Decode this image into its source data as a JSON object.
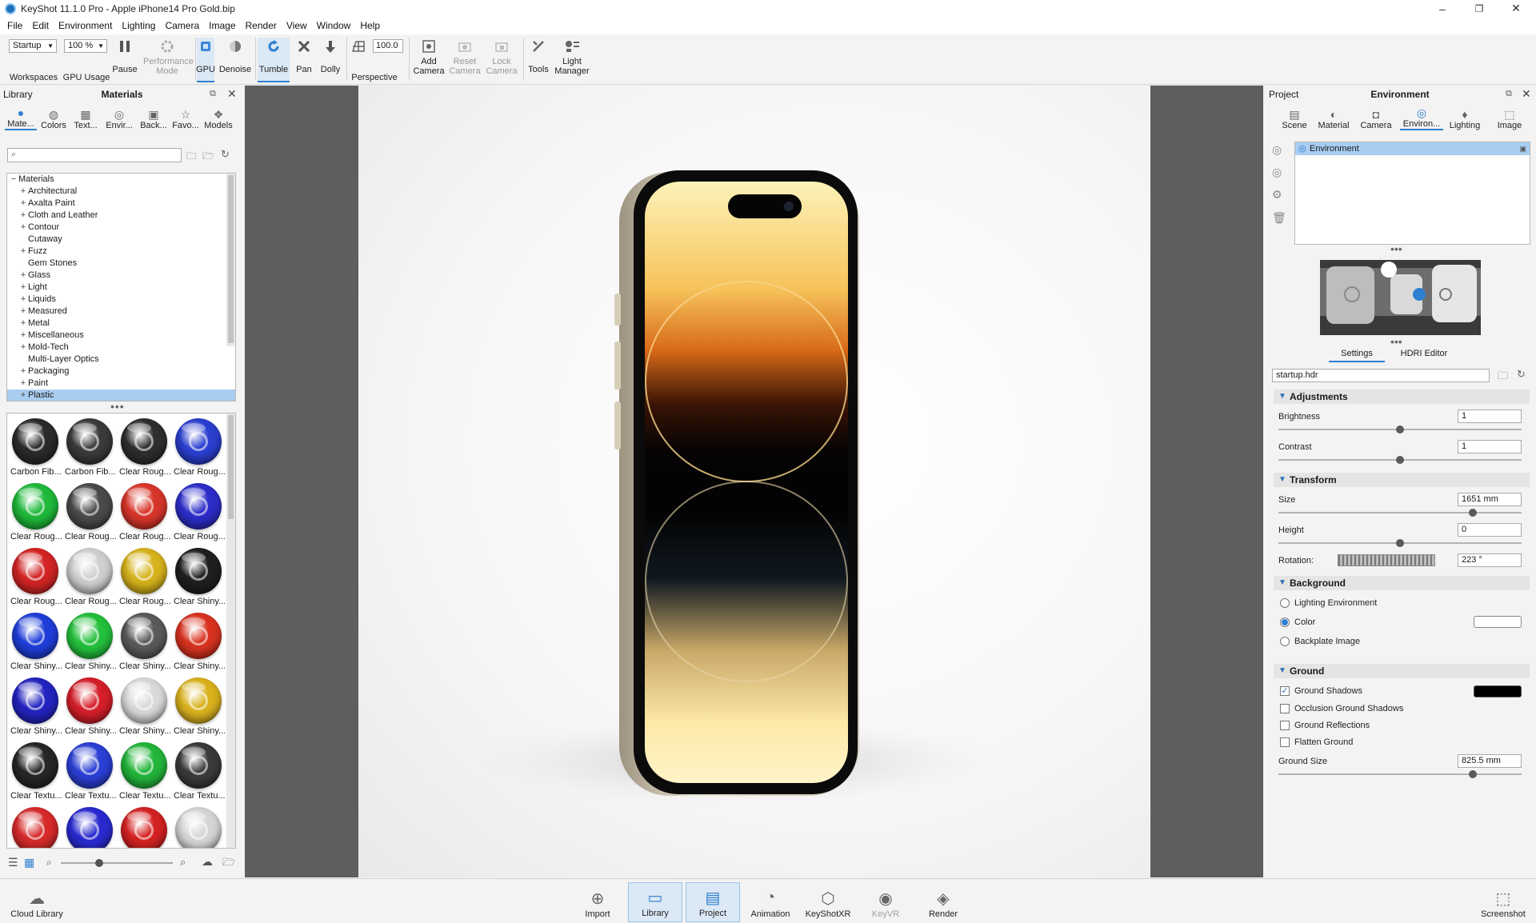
{
  "titlebar": {
    "title": "KeyShot 11.1.0 Pro  - Apple iPhone14 Pro Gold.bip",
    "minimize": "–",
    "maximize": "❐",
    "close": "✕"
  },
  "menubar": [
    "File",
    "Edit",
    "Environment",
    "Lighting",
    "Camera",
    "Image",
    "Render",
    "View",
    "Window",
    "Help"
  ],
  "toolbar": {
    "workspace_value": "Startup",
    "gpu_usage_value": "100 %",
    "perspective_value": "100.0",
    "buttons": {
      "workspaces": "Workspaces",
      "gpu_usage": "GPU Usage",
      "pause": "Pause",
      "performance_mode": "Performance Mode",
      "gpu": "GPU",
      "denoise": "Denoise",
      "tumble": "Tumble",
      "pan": "Pan",
      "dolly": "Dolly",
      "perspective": "Perspective",
      "add_camera": "Add Camera",
      "reset_camera": "Reset Camera",
      "lock_camera": "Lock Camera",
      "tools": "Tools",
      "light_manager": "Light Manager"
    }
  },
  "library": {
    "header_left": "Library",
    "title": "Materials",
    "tabs": [
      "Mate...",
      "Colors",
      "Text...",
      "Envir...",
      "Back...",
      "Favo...",
      "Models"
    ],
    "search_placeholder": "",
    "tree_root": "Materials",
    "tree_items": [
      {
        "label": "Architectural",
        "expandable": true
      },
      {
        "label": "Axalta Paint",
        "expandable": true
      },
      {
        "label": "Cloth and Leather",
        "expandable": true
      },
      {
        "label": "Contour",
        "expandable": true
      },
      {
        "label": "Cutaway",
        "expandable": false
      },
      {
        "label": "Fuzz",
        "expandable": true
      },
      {
        "label": "Gem Stones",
        "expandable": false
      },
      {
        "label": "Glass",
        "expandable": true
      },
      {
        "label": "Light",
        "expandable": true
      },
      {
        "label": "Liquids",
        "expandable": true
      },
      {
        "label": "Measured",
        "expandable": true
      },
      {
        "label": "Metal",
        "expandable": true
      },
      {
        "label": "Miscellaneous",
        "expandable": true
      },
      {
        "label": "Mold-Tech",
        "expandable": true
      },
      {
        "label": "Multi-Layer Optics",
        "expandable": false
      },
      {
        "label": "Packaging",
        "expandable": true
      },
      {
        "label": "Paint",
        "expandable": true
      },
      {
        "label": "Plastic",
        "expandable": true,
        "selected": true
      }
    ],
    "thumbnails": [
      {
        "label": "Carbon Fib...",
        "color": "#2a2a2a"
      },
      {
        "label": "Carbon Fib...",
        "color": "#3a3a3a"
      },
      {
        "label": "Clear Roug...",
        "color": "#2e2e2e"
      },
      {
        "label": "Clear Roug...",
        "color": "#2a3fd0"
      },
      {
        "label": "Clear Roug...",
        "color": "#1fb83a"
      },
      {
        "label": "Clear Roug...",
        "color": "#4a4a4a"
      },
      {
        "label": "Clear Roug...",
        "color": "#d8352b"
      },
      {
        "label": "Clear Roug...",
        "color": "#2c2cc8"
      },
      {
        "label": "Clear Roug...",
        "color": "#d22424"
      },
      {
        "label": "Clear Roug...",
        "color": "#cfcfcf"
      },
      {
        "label": "Clear Roug...",
        "color": "#d6b21c"
      },
      {
        "label": "Clear Shiny...",
        "color": "#1f1f1f"
      },
      {
        "label": "Clear Shiny...",
        "color": "#1f3ed8"
      },
      {
        "label": "Clear Shiny...",
        "color": "#24c03c"
      },
      {
        "label": "Clear Shiny...",
        "color": "#5a5a5a"
      },
      {
        "label": "Clear Shiny...",
        "color": "#d8321f"
      },
      {
        "label": "Clear Shiny...",
        "color": "#2323c0"
      },
      {
        "label": "Clear Shiny...",
        "color": "#d51f2a"
      },
      {
        "label": "Clear Shiny...",
        "color": "#d9d9d9"
      },
      {
        "label": "Clear Shiny...",
        "color": "#dab21e"
      },
      {
        "label": "Clear Textu...",
        "color": "#262626"
      },
      {
        "label": "Clear Textu...",
        "color": "#2a3fd4"
      },
      {
        "label": "Clear Textu...",
        "color": "#22b53a"
      },
      {
        "label": "Clear Textu...",
        "color": "#3a3a3a"
      },
      {
        "label": "",
        "color": "#d62a2a"
      },
      {
        "label": "",
        "color": "#2a2ad0"
      },
      {
        "label": "",
        "color": "#d42222"
      },
      {
        "label": "",
        "color": "#d5d5d5"
      }
    ]
  },
  "project": {
    "header_left": "Project",
    "title": "Environment",
    "tabs": [
      "Scene",
      "Material",
      "Camera",
      "Environ...",
      "Lighting",
      "Image"
    ],
    "env_list_item": "Environment",
    "subtabs": [
      "Settings",
      "HDRI Editor"
    ],
    "hdr_file": "startup.hdr",
    "sections": {
      "adjustments": "Adjustments",
      "transform": "Transform",
      "background": "Background",
      "ground": "Ground"
    },
    "brightness": {
      "label": "Brightness",
      "value": "1",
      "level": 0.5
    },
    "contrast": {
      "label": "Contrast",
      "value": "1",
      "level": 0.5
    },
    "size": {
      "label": "Size",
      "value": "1651 mm",
      "level": 0.8
    },
    "height": {
      "label": "Height",
      "value": "0",
      "level": 0.5
    },
    "rotation": {
      "label": "Rotation:",
      "value": "223 °"
    },
    "background_options": [
      {
        "label": "Lighting Environment",
        "selected": false
      },
      {
        "label": "Color",
        "selected": true
      },
      {
        "label": "Backplate Image",
        "selected": false
      }
    ],
    "background_color": "#ffffff",
    "ground_options": [
      {
        "label": "Ground Shadows",
        "checked": true
      },
      {
        "label": "Occlusion Ground Shadows",
        "checked": false
      },
      {
        "label": "Ground Reflections",
        "checked": false
      },
      {
        "label": "Flatten Ground",
        "checked": false
      }
    ],
    "ground_shadow_color": "#000000",
    "ground_size": {
      "label": "Ground Size",
      "value": "825.5 mm",
      "level": 0.8
    }
  },
  "bottombar": {
    "cloud_library": "Cloud Library",
    "buttons": [
      {
        "label": "Import",
        "icon": "import-icon"
      },
      {
        "label": "Library",
        "icon": "library-icon",
        "active": true
      },
      {
        "label": "Project",
        "icon": "project-icon",
        "active": true
      },
      {
        "label": "Animation",
        "icon": "animation-icon"
      },
      {
        "label": "KeyShotXR",
        "icon": "keyshotxr-icon"
      },
      {
        "label": "KeyVR",
        "icon": "keyvr-icon",
        "disabled": true
      },
      {
        "label": "Render",
        "icon": "render-icon"
      }
    ],
    "screenshot": "Screenshot"
  },
  "colors": {
    "accent": "#2f7fd1",
    "selection": "#a9cdf0",
    "viewport_surround": "#5e5e5e"
  }
}
